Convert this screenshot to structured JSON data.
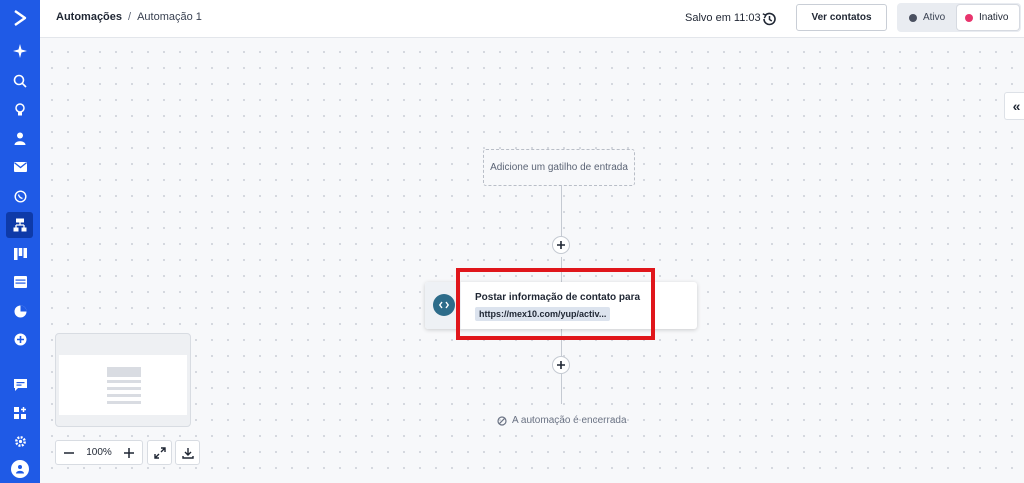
{
  "header": {
    "breadcrumb_root": "Automações",
    "breadcrumb_sep": "/",
    "breadcrumb_current": "Automação 1",
    "saved_text": "Salvo em 11:03",
    "view_contacts_label": "Ver contatos",
    "status_active_label": "Ativo",
    "status_inactive_label": "Inativo",
    "status_selected": "Inativo"
  },
  "sidebar": {
    "items": [
      {
        "icon": "logo-chevron-icon"
      },
      {
        "icon": "sparkle-icon"
      },
      {
        "icon": "search-icon"
      },
      {
        "icon": "lightbulb-icon"
      },
      {
        "icon": "contacts-icon"
      },
      {
        "icon": "email-icon"
      },
      {
        "icon": "whatsapp-icon"
      },
      {
        "icon": "automations-icon",
        "active": true
      },
      {
        "icon": "pipeline-icon"
      },
      {
        "icon": "site-icon"
      },
      {
        "icon": "reports-icon"
      },
      {
        "icon": "add-circle-icon"
      },
      {
        "icon": "chat-icon"
      },
      {
        "icon": "apps-icon"
      },
      {
        "icon": "settings-icon"
      },
      {
        "icon": "avatar-icon"
      }
    ]
  },
  "canvas": {
    "trigger_placeholder": "Adicione um gatilho de entrada",
    "action_title": "Postar informação de contato para",
    "action_url": "https://mex10.com/yup/activ...",
    "end_text": "A automação é encerrada",
    "zoom_level": "100%"
  },
  "colors": {
    "sidebar_bg": "#1f5ae6",
    "sidebar_active": "#0e3aa8",
    "highlight": "#e0161b",
    "inactive_dot": "#e8356d",
    "active_dot": "#4a5060",
    "webhook_icon_bg": "#2d6c8a"
  }
}
